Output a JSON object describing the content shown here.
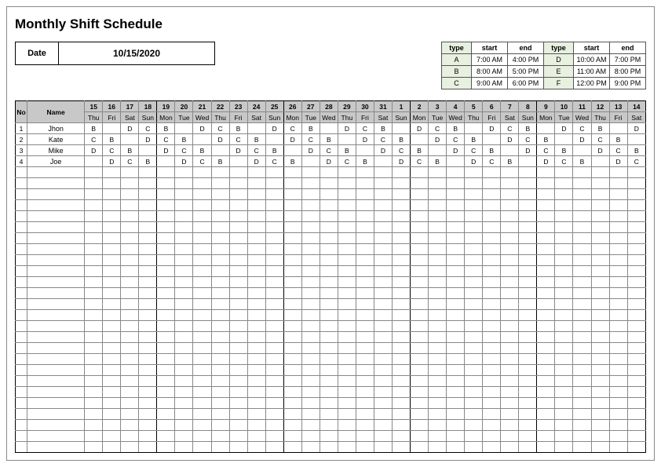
{
  "title": "Monthly Shift Schedule",
  "date_label": "Date",
  "date_value": "10/15/2020",
  "shift_type_headers": [
    "type",
    "start",
    "end",
    "type",
    "start",
    "end"
  ],
  "shift_type_rows": [
    [
      "A",
      "7:00 AM",
      "4:00 PM",
      "D",
      "10:00 AM",
      "7:00 PM"
    ],
    [
      "B",
      "8:00 AM",
      "5:00 PM",
      "E",
      "11:00 AM",
      "8:00 PM"
    ],
    [
      "C",
      "9:00 AM",
      "6:00 PM",
      "F",
      "12:00 PM",
      "9:00 PM"
    ]
  ],
  "schedule_headers": {
    "no": "No",
    "name": "Name",
    "days": [
      "15",
      "16",
      "17",
      "18",
      "19",
      "20",
      "21",
      "22",
      "23",
      "24",
      "25",
      "26",
      "27",
      "28",
      "29",
      "30",
      "31",
      "1",
      "2",
      "3",
      "4",
      "5",
      "6",
      "7",
      "8",
      "9",
      "10",
      "11",
      "12",
      "13",
      "14"
    ],
    "dows": [
      "Thu",
      "Fri",
      "Sat",
      "Sun",
      "Mon",
      "Tue",
      "Wed",
      "Thu",
      "Fri",
      "Sat",
      "Sun",
      "Mon",
      "Tue",
      "Wed",
      "Thu",
      "Fri",
      "Sat",
      "Sun",
      "Mon",
      "Tue",
      "Wed",
      "Thu",
      "Fri",
      "Sat",
      "Sun",
      "Mon",
      "Tue",
      "Wed",
      "Thu",
      "Fri",
      "Sat"
    ]
  },
  "employees": [
    {
      "no": "1",
      "name": "Jhon",
      "shifts": [
        "B",
        "",
        "D",
        "C",
        "B",
        "",
        "D",
        "C",
        "B",
        "",
        "D",
        "C",
        "B",
        "",
        "D",
        "C",
        "B",
        "",
        "D",
        "C",
        "B",
        "",
        "D",
        "C",
        "B",
        "",
        "D",
        "C",
        "B",
        "",
        "D"
      ]
    },
    {
      "no": "2",
      "name": "Kate",
      "shifts": [
        "C",
        "B",
        "",
        "D",
        "C",
        "B",
        "",
        "D",
        "C",
        "B",
        "",
        "D",
        "C",
        "B",
        "",
        "D",
        "C",
        "B",
        "",
        "D",
        "C",
        "B",
        "",
        "D",
        "C",
        "B",
        "",
        "D",
        "C",
        "B",
        ""
      ]
    },
    {
      "no": "3",
      "name": "Mike",
      "shifts": [
        "D",
        "C",
        "B",
        "",
        "D",
        "C",
        "B",
        "",
        "D",
        "C",
        "B",
        "",
        "D",
        "C",
        "B",
        "",
        "D",
        "C",
        "B",
        "",
        "D",
        "C",
        "B",
        "",
        "D",
        "C",
        "B",
        "",
        "D",
        "C",
        "B"
      ]
    },
    {
      "no": "4",
      "name": "Joe",
      "shifts": [
        "",
        "D",
        "C",
        "B",
        "",
        "D",
        "C",
        "B",
        "",
        "D",
        "C",
        "B",
        "",
        "D",
        "C",
        "B",
        "",
        "D",
        "C",
        "B",
        "",
        "D",
        "C",
        "B",
        "",
        "D",
        "C",
        "B",
        "",
        "D",
        "C"
      ]
    }
  ],
  "empty_rows": 26,
  "thick_left_days": [
    0,
    4,
    11,
    18,
    25
  ],
  "thick_right_days": [
    3,
    10,
    17,
    24,
    30
  ]
}
